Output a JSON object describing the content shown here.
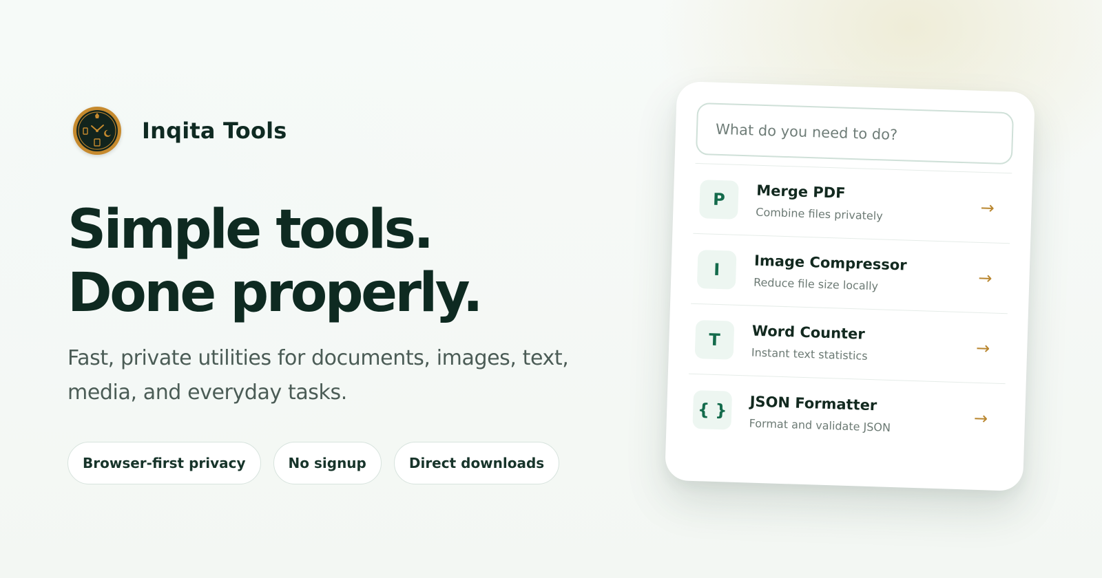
{
  "brand": {
    "name": "Inqita Tools",
    "logo_icon": "clock-tools-icon",
    "logo_color": "#c68a2e"
  },
  "hero": {
    "headline_line1": "Simple tools.",
    "headline_line2": "Done properly.",
    "subtext": "Fast, private utilities for documents, images, text, media, and everyday tasks."
  },
  "pills": [
    {
      "label": "Browser-first privacy"
    },
    {
      "label": "No signup"
    },
    {
      "label": "Direct downloads"
    }
  ],
  "card": {
    "search_placeholder": "What do you need to do?",
    "tools": [
      {
        "icon_text": "P",
        "name": "Merge PDF",
        "description": "Combine files privately",
        "arrow": "→"
      },
      {
        "icon_text": "I",
        "name": "Image Compressor",
        "description": "Reduce file size locally",
        "arrow": "→"
      },
      {
        "icon_text": "T",
        "name": "Word Counter",
        "description": "Instant text statistics",
        "arrow": "→"
      },
      {
        "icon_text": "{ }",
        "name": "JSON Formatter",
        "description": "Format and validate JSON",
        "arrow": "→"
      }
    ]
  },
  "colors": {
    "heading": "#0e2a21",
    "accent_green": "#146b4c",
    "accent_gold": "#b9862f"
  }
}
